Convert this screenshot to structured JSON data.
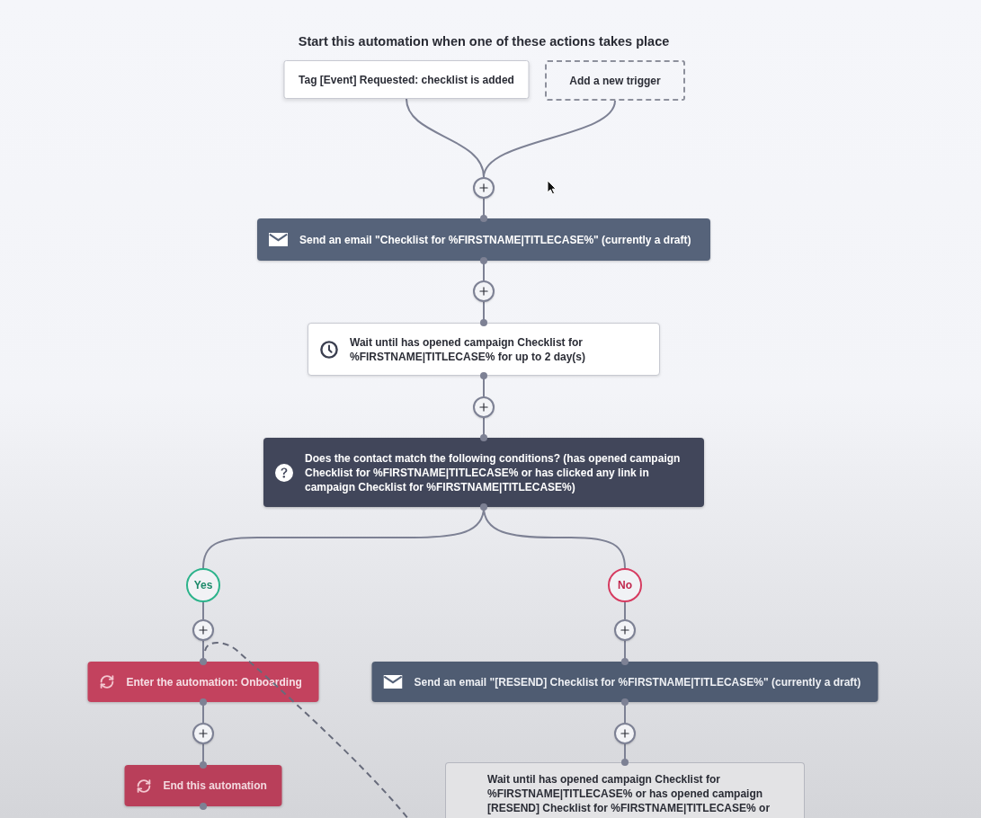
{
  "title": "Start this automation when one of these actions takes place",
  "triggers": [
    {
      "kind": "tag",
      "label": "Tag [Event] Requested: checklist is added"
    },
    {
      "kind": "add",
      "label": "Add a new trigger"
    }
  ],
  "steps": [
    {
      "kind": "email",
      "label": "Send an email \"Checklist for %FIRSTNAME|TITLECASE%\" (currently a draft)"
    },
    {
      "kind": "wait",
      "label": "Wait until has opened campaign Checklist for %FIRSTNAME|TITLECASE% for up to 2 day(s)"
    },
    {
      "kind": "condition",
      "label": "Does the contact match the following conditions? (has opened campaign Checklist for %FIRSTNAME|TITLECASE% or has clicked any link in campaign Checklist for %FIRSTNAME|TITLECASE%)"
    }
  ],
  "branches": [
    {
      "kind": "yes",
      "label": "Yes",
      "steps": [
        {
          "kind": "goto",
          "label": "Enter the automation: Onboarding"
        },
        {
          "kind": "end",
          "label": "End this automation"
        }
      ]
    },
    {
      "kind": "no",
      "label": "No",
      "steps": [
        {
          "kind": "email",
          "label": "Send an email \"[RESEND] Checklist for %FIRSTNAME|TITLECASE%\" (currently a draft)"
        },
        {
          "kind": "wait",
          "label": "Wait until has opened campaign Checklist for %FIRSTNAME|TITLECASE% or has opened campaign [RESEND] Checklist for %FIRSTNAME|TITLECASE% or",
          "cut_off": true
        }
      ]
    }
  ]
}
